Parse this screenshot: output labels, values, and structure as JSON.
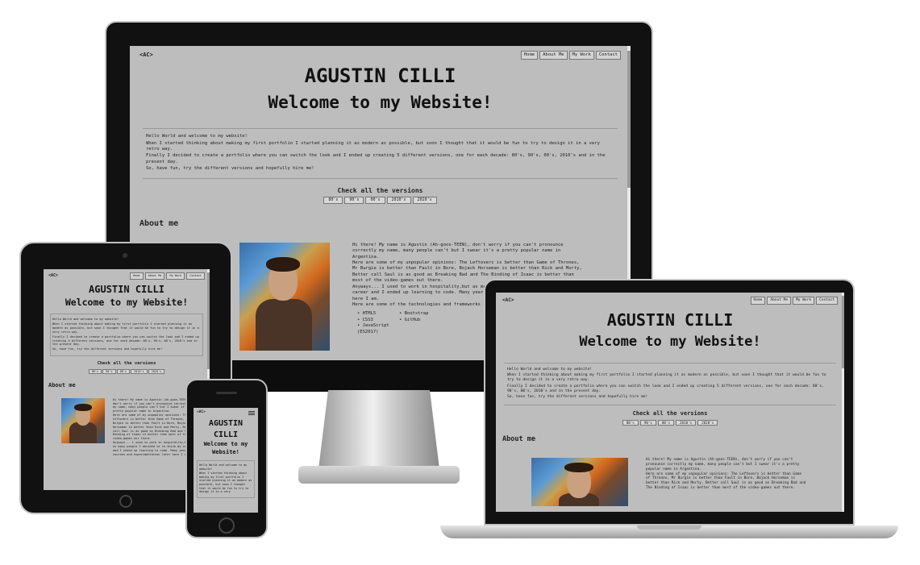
{
  "site": {
    "logo": "<AC>",
    "nav": [
      "Home",
      "About Me",
      "My Work",
      "Contact"
    ],
    "name": "AGUSTIN CILLI",
    "welcome": "Welcome to my Website!",
    "welcome_line1": "Welcome to my",
    "welcome_line2": "Website!",
    "name_line1": "AGUSTIN",
    "name_line2": "CILLI",
    "intro": [
      "Hello World and welcome to my website!",
      "When I started thinking about making my first portfolio I started planning it as modern as possible, but soon I thought that it would be fun to try to design it in a very retro way.",
      "Finally I decided to create a portfolio where you can switch the look and I ended up creating 5 different versions, one for each decade: 80's, 90's, 00's, 2010's and in the present day.",
      "So, have fun, try the different versions and hopefully hire me!"
    ],
    "check_versions": "Check all the versions",
    "versions": [
      "80's",
      "90's",
      "00's",
      "2010's",
      "2020's"
    ],
    "about_title": "About me",
    "about_text": [
      "Hi there! My name is Agustin (Ah-goos-TEEN), don't worry if you can't pronounce correctly my name, many people can't but I swear it's a pretty popular name in Argentina.",
      "Here are some of my unpopular opinions: The Leftovers is better than Game of Thrones, Mr Burgie is better than Fault in Bore, Bojack Horseman is better than Rick and Morty, Better call Saul is as good as Breaking Bad and The Binding of Isaac is better than most of the video-games out there.",
      "Anyways... I used to work in hospitality,but as many people I decided to re-think my career and I ended up learning to code. Many years, courses and experimentation later here I am.",
      "Here are some of the technologies and frameworks I work with:"
    ],
    "skills": [
      "HTML5",
      "Bootstrap",
      "CSS3",
      "GitHub",
      "JavaScript",
      "(ES2017)"
    ],
    "phone_intro": [
      "Hello World and welcome to my website!",
      "When I started thinking about making my first portfolio I started planning it as modern as possible, but soon I thought that it would be fun to try to design it in a very"
    ]
  }
}
